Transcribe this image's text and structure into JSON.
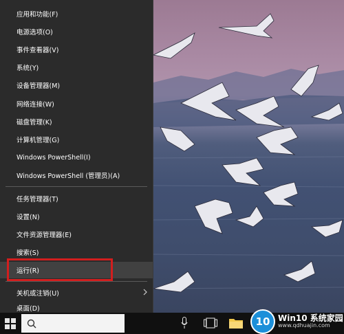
{
  "menu": {
    "items": [
      {
        "label": "应用和功能(F)"
      },
      {
        "label": "电源选项(O)"
      },
      {
        "label": "事件查看器(V)"
      },
      {
        "label": "系统(Y)"
      },
      {
        "label": "设备管理器(M)"
      },
      {
        "label": "网络连接(W)"
      },
      {
        "label": "磁盘管理(K)"
      },
      {
        "label": "计算机管理(G)"
      },
      {
        "label": "Windows PowerShell(I)"
      },
      {
        "label": "Windows PowerShell (管理员)(A)"
      },
      {
        "label": "任务管理器(T)"
      },
      {
        "label": "设置(N)"
      },
      {
        "label": "文件资源管理器(E)"
      },
      {
        "label": "搜索(S)"
      },
      {
        "label": "运行(R)"
      },
      {
        "label": "关机或注销(U)"
      },
      {
        "label": "桌面(D)"
      }
    ]
  },
  "highlight_color": "#d21e1e",
  "watermark": {
    "logo_text": "10",
    "title": "Win10 系统家园",
    "url": "www.qdhuajin.com"
  },
  "taskbar": {
    "icons": [
      "start-icon",
      "search-box",
      "microphone-icon",
      "task-view-icon",
      "file-explorer-icon"
    ]
  }
}
